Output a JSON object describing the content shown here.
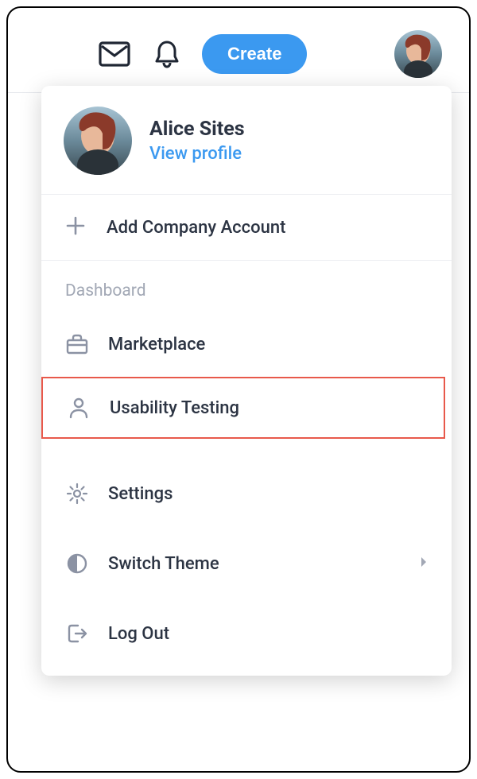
{
  "topbar": {
    "create_label": "Create"
  },
  "dropdown": {
    "profile": {
      "name": "Alice Sites",
      "view_profile": "View profile"
    },
    "add_company": "Add Company Account",
    "section_label": "Dashboard",
    "items": [
      {
        "label": "Marketplace",
        "icon": "briefcase"
      },
      {
        "label": "Usability Testing",
        "icon": "person",
        "highlighted": true
      }
    ],
    "settings": "Settings",
    "switch_theme": "Switch Theme",
    "log_out": "Log Out"
  }
}
